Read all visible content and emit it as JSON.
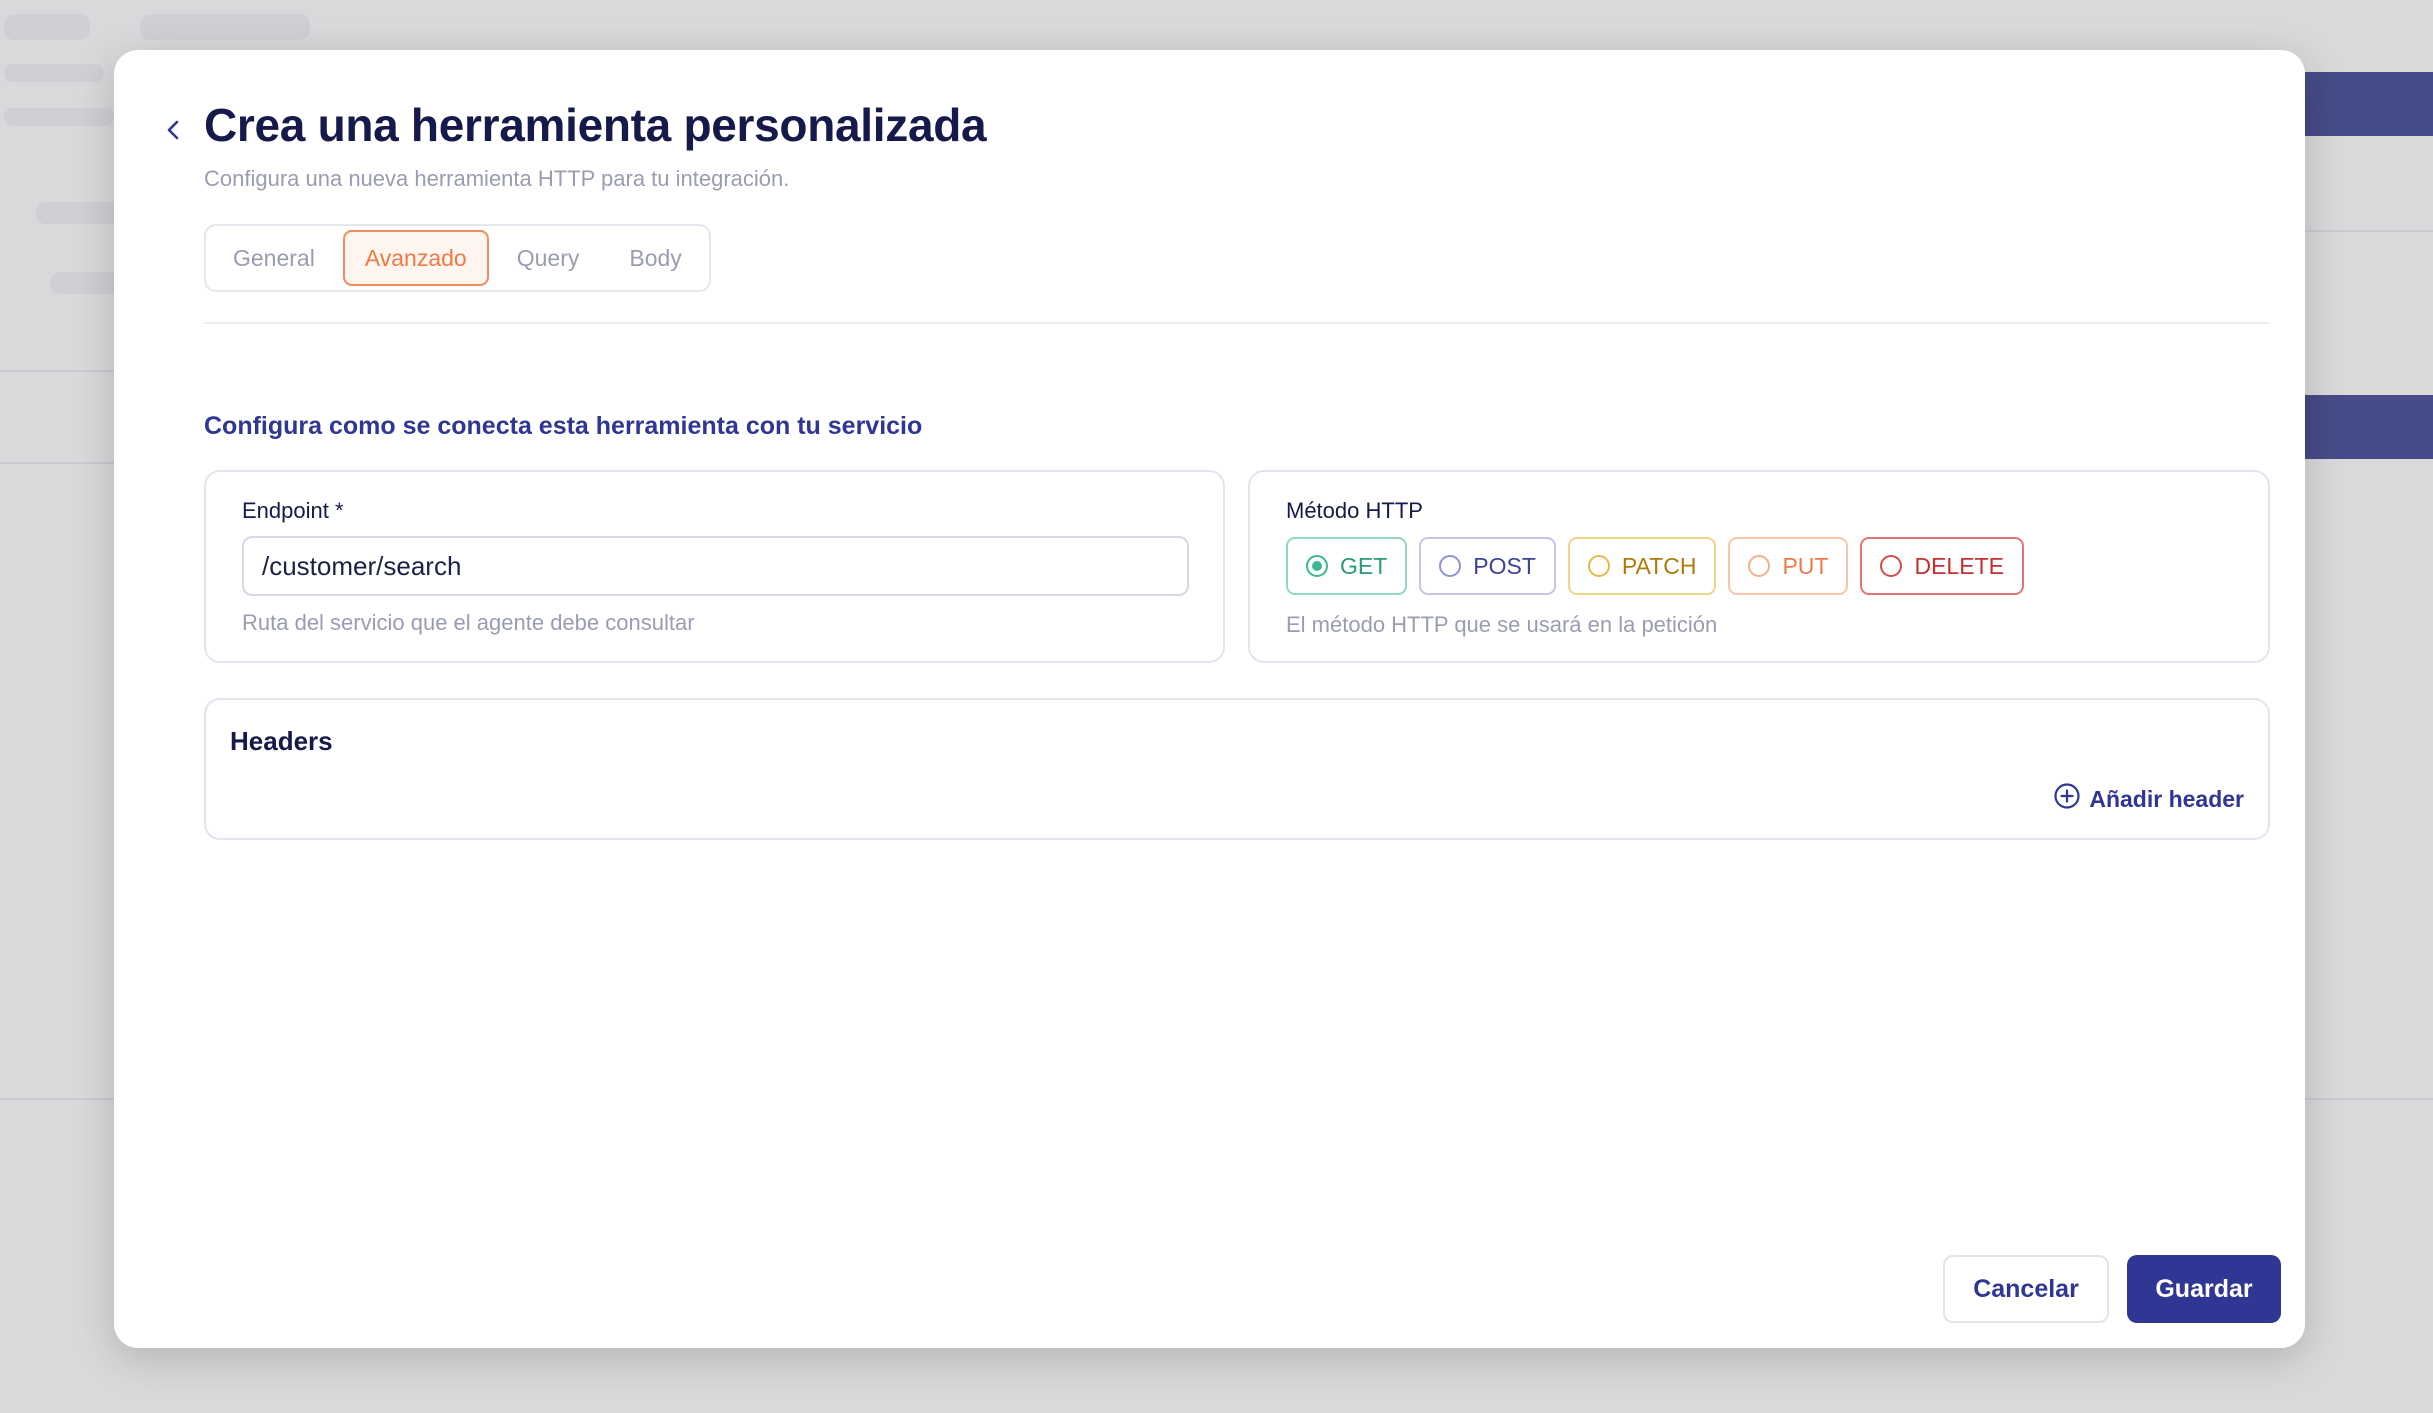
{
  "modal": {
    "title": "Crea una herramienta personalizada",
    "subtitle": "Configura una nueva herramienta HTTP para tu integración.",
    "back_icon": "chevron-left-icon"
  },
  "tabs": [
    {
      "label": "General",
      "active": false
    },
    {
      "label": "Avanzado",
      "active": true
    },
    {
      "label": "Query",
      "active": false
    },
    {
      "label": "Body",
      "active": false
    }
  ],
  "section_title": "Configura como se conecta esta herramienta con tu servicio",
  "endpoint": {
    "label": "Endpoint *",
    "value": "/customer/search",
    "help": "Ruta del servicio que el agente debe consultar"
  },
  "http_method": {
    "label": "Método HTTP",
    "options": [
      {
        "label": "GET",
        "checked": true,
        "color": "#3db892"
      },
      {
        "label": "POST",
        "checked": false,
        "color": "#6c70c4"
      },
      {
        "label": "PATCH",
        "checked": false,
        "color": "#e0a21c"
      },
      {
        "label": "PUT",
        "checked": false,
        "color": "#f0884a"
      },
      {
        "label": "DELETE",
        "checked": false,
        "color": "#d83a3a"
      }
    ],
    "help": "El método HTTP que se usará en la petición"
  },
  "headers": {
    "title": "Headers",
    "add_label": "Añadir header",
    "add_icon": "plus-circle-icon"
  },
  "actions": {
    "cancel_label": "Cancelar",
    "save_label": "Guardar"
  },
  "colors": {
    "primary": "#2f3694",
    "accent": "#ef7a45",
    "title": "#161a4a"
  }
}
